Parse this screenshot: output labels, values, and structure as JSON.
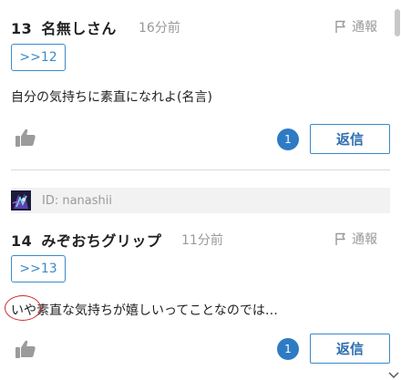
{
  "posts": [
    {
      "number": "13",
      "name": "名無しさん",
      "time": "16分前",
      "report_label": "通報",
      "anchor": ">>12",
      "body": "自分の気持ちに素直になれよ(名言)",
      "reply_count": "1",
      "reply_label": "返信"
    },
    {
      "user_id": "ID: nanashii",
      "number": "14",
      "name": "みぞおちグリップ",
      "time": "11分前",
      "report_label": "通報",
      "anchor": ">>13",
      "body_first": "いや",
      "body_rest": "素直な気持ちが嬉しいってことなのでは…",
      "reply_count": "1",
      "reply_label": "返信"
    }
  ],
  "colors": {
    "accent": "#3a8ac8",
    "badge": "#2e7bc4",
    "annotation_circle": "#cc2a2a"
  },
  "icons": {
    "report": "flag-icon",
    "like": "thumbs-up-icon",
    "scroll": "chevron-down-icon"
  }
}
